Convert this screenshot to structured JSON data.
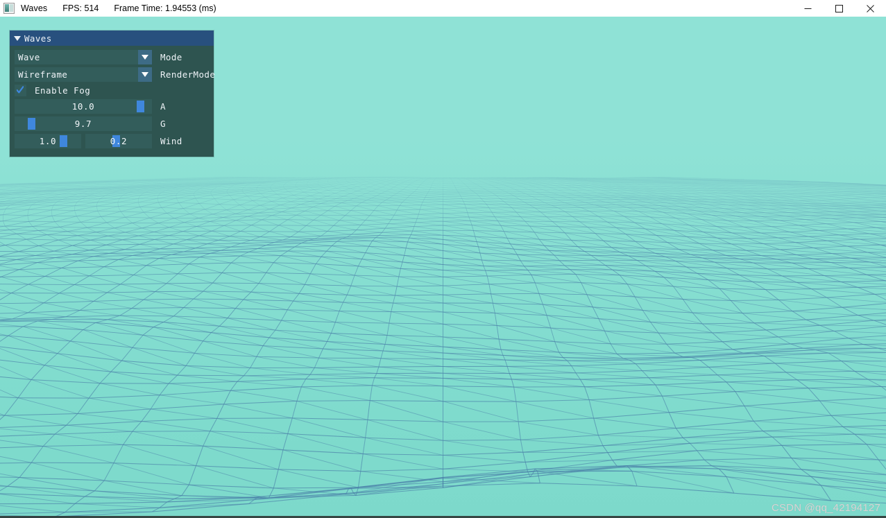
{
  "window": {
    "icon": "app-window-icon",
    "title": "Waves",
    "fps_label": "FPS: 514",
    "frame_time_label": "Frame Time: 1.94553 (ms)",
    "controls": {
      "minimize": "minimize-icon",
      "maximize": "maximize-icon",
      "close": "close-icon"
    }
  },
  "panel": {
    "title": "Waves",
    "collapse_icon": "triangle-down-icon",
    "combos": [
      {
        "value": "Wave",
        "label": "Mode",
        "arrow_icon": "chevron-down-icon"
      },
      {
        "value": "Wireframe",
        "label": "RenderMode",
        "arrow_icon": "chevron-down-icon"
      }
    ],
    "checkbox": {
      "label": "Enable Fog",
      "checked": true,
      "check_icon": "check-icon"
    },
    "sliders": [
      {
        "label": "A",
        "value": "10.0",
        "fill_percent": 94
      },
      {
        "label": "G",
        "value": "9.7",
        "fill_percent": 10
      }
    ],
    "wind": {
      "label": "Wind",
      "x": {
        "value": "1.0",
        "fill_percent": 76
      },
      "y": {
        "value": "0.2",
        "fill_percent": 46
      }
    }
  },
  "viewport": {
    "watermark": "CSDN @qq_42194127",
    "colors": {
      "water": "#7fdbcd",
      "fog": "#8fe2d6",
      "wireframe": "#4a7fa8"
    }
  }
}
